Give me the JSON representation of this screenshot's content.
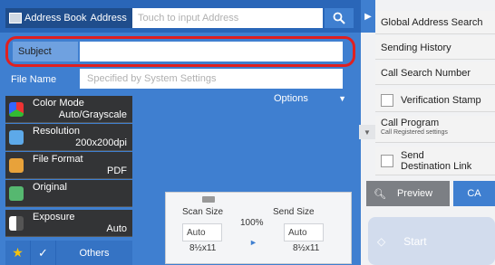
{
  "colors": {
    "blue_panel": "#3f7fd0",
    "dark_button": "#333436",
    "highlight_border": "#e02020"
  },
  "header": {
    "address_book_label": "Address Book",
    "address_label": "Address",
    "address_placeholder": "Touch to input Address",
    "search_icon": "search-icon"
  },
  "form": {
    "subject_label": "Subject",
    "subject_value": "",
    "file_name_label": "File Name",
    "file_name_placeholder": "Specified by System Settings",
    "options_label": "Options"
  },
  "modes": [
    {
      "label": "Color Mode",
      "value": "Auto/Grayscale",
      "icon": "color-mode-icon"
    },
    {
      "label": "Resolution",
      "value": "200x200dpi",
      "icon": "resolution-icon"
    },
    {
      "label": "File Format",
      "value": "PDF",
      "icon": "file-format-icon"
    },
    {
      "label": "Original",
      "value": "",
      "icon": "original-icon"
    },
    {
      "label": "Exposure",
      "value": "Auto",
      "icon": "exposure-icon"
    }
  ],
  "bottom_bar": {
    "others_label": "Others"
  },
  "size": {
    "scan_size_label": "Scan Size",
    "scan_size_value": "Auto",
    "scan_paper": "8½x11",
    "ratio": "100%",
    "send_size_label": "Send Size",
    "send_size_value": "Auto",
    "send_paper": "8½x11"
  },
  "right_menu": {
    "global_address_search": "Global Address Search",
    "sending_history": "Sending History",
    "call_search_number": "Call Search Number",
    "verification_stamp": "Verification Stamp",
    "call_program": "Call Program",
    "call_registered_settings": "Call Registered settings",
    "send_destination_link_line1": "Send",
    "send_destination_link_line2": "Destination Link"
  },
  "actions": {
    "preview_label": "Preview",
    "ca_label": "CA",
    "start_label": "Start"
  }
}
